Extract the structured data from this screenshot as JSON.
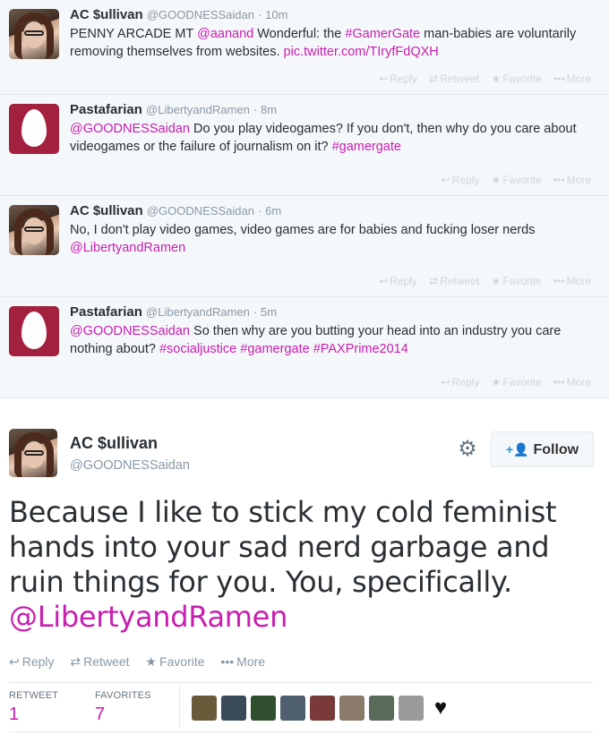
{
  "tweets": [
    {
      "name": "AC $ullivan",
      "handle": "@GOODNESSaidan",
      "time": "· 10m",
      "text_a": "PENNY ARCADE MT ",
      "mention": "@aanand",
      "text_b": " Wonderful: the ",
      "hashtag": "#GamerGate",
      "text_c": " man-babies are voluntarily removing themselves from websites. ",
      "link": "pic.twitter.com/TIryfFdQXH",
      "actions": {
        "reply": "Reply",
        "retweet": "Retweet",
        "favorite": "Favorite",
        "more": "More"
      }
    },
    {
      "name": "Pastafarian",
      "handle": "@LibertyandRamen",
      "time": "· 8m",
      "mention": "@GOODNESSaidan",
      "text_a": " Do you play videogames? If you don't, then why do you care about videogames or the failure of journalism on it? ",
      "hashtag": "#gamergate",
      "actions": {
        "reply": "Reply",
        "favorite": "Favorite",
        "more": "More"
      }
    },
    {
      "name": "AC $ullivan",
      "handle": "@GOODNESSaidan",
      "time": "· 6m",
      "text_a": "No, I don't play video games, video games are for babies and fucking loser nerds ",
      "mention": "@LibertyandRamen",
      "actions": {
        "reply": "Reply",
        "retweet": "Retweet",
        "favorite": "Favorite",
        "more": "More"
      }
    },
    {
      "name": "Pastafarian",
      "handle": "@LibertyandRamen",
      "time": "· 5m",
      "mention": "@GOODNESSaidan",
      "text_a": " So then why are you butting your head into an industry you care nothing about? ",
      "hashtag1": "#socialjustice",
      "hashtag2": "#gamergate",
      "hashtag3": "#PAXPrime2014",
      "actions": {
        "reply": "Reply",
        "favorite": "Favorite",
        "more": "More"
      }
    }
  ],
  "main": {
    "name": "AC $ullivan",
    "handle": "@GOODNESSaidan",
    "follow_label": "Follow",
    "text": "Because I like to stick my cold feminist hands into your sad nerd garbage and ruin things for you. You, specifically.",
    "mention": "@LibertyandRamen",
    "actions": {
      "reply": "Reply",
      "retweet": "Retweet",
      "favorite": "Favorite",
      "more": "More"
    },
    "stats": {
      "retweet_label": "RETWEET",
      "retweet_count": "1",
      "favorites_label": "FAVORITES",
      "favorites_count": "7"
    }
  },
  "colors": {
    "link": "#c81eb0",
    "muted": "#8899a6",
    "background_thread": "#f5f8fa"
  }
}
